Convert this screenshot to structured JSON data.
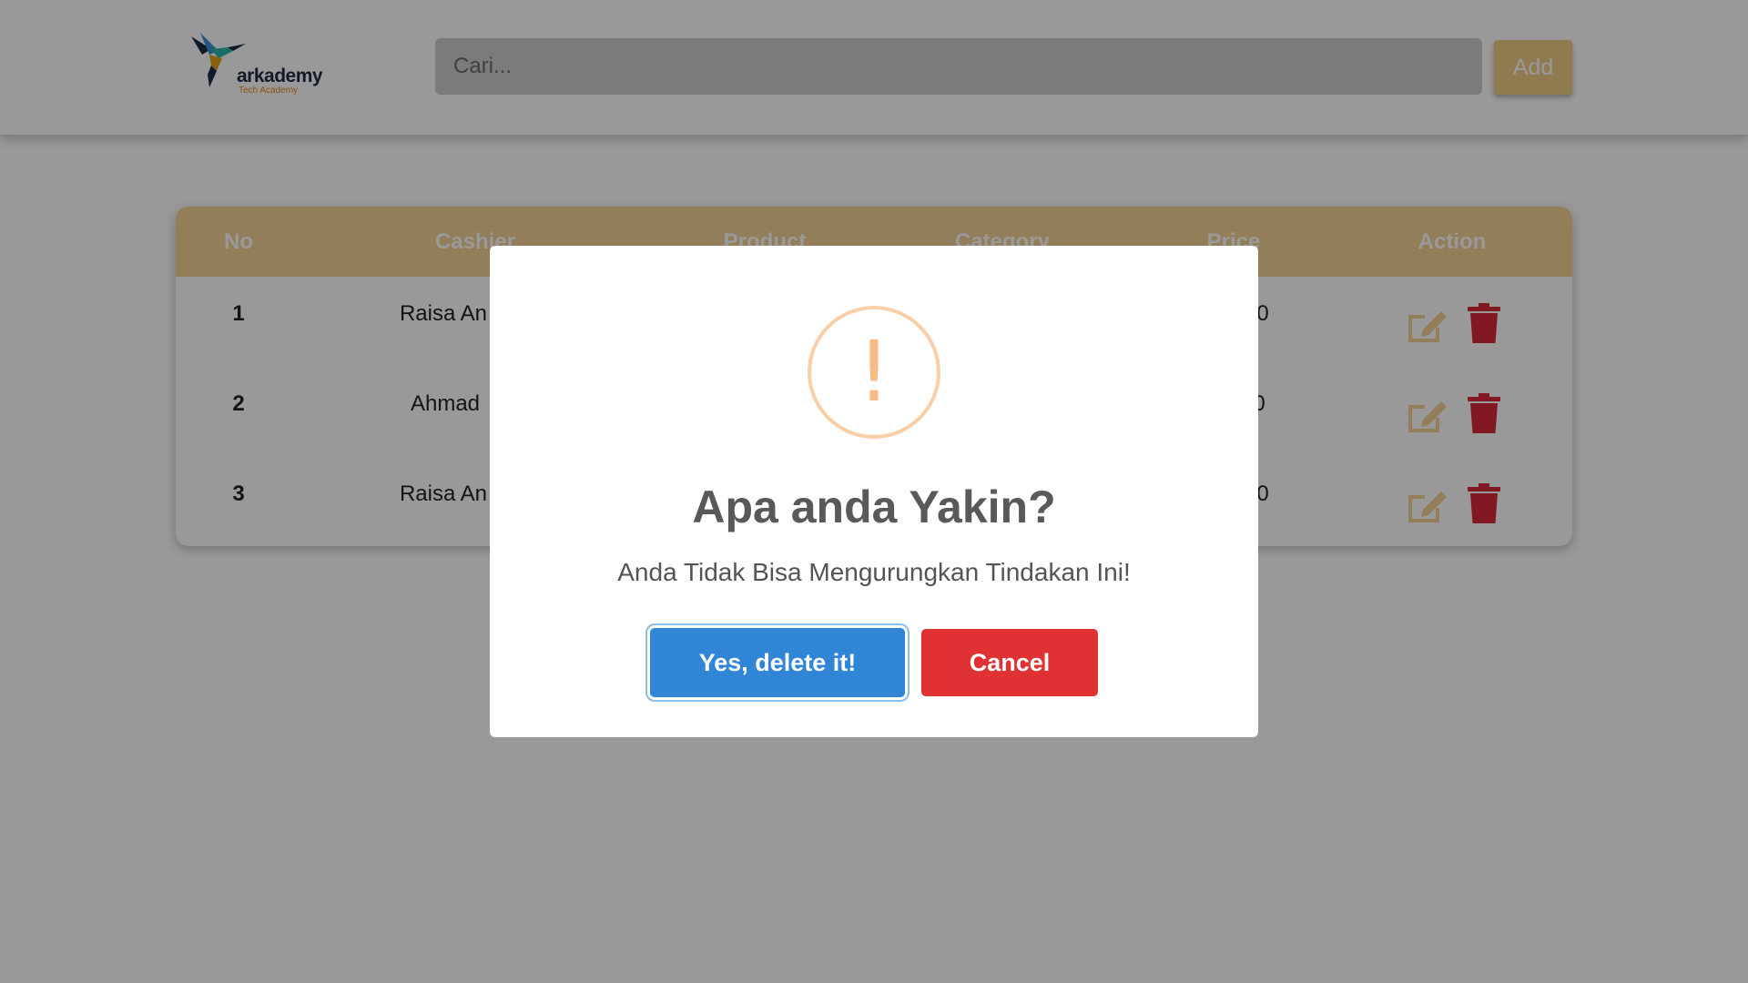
{
  "header": {
    "logo_text": "arkademy",
    "logo_subtext": "Tech Academy",
    "search_placeholder": "Cari...",
    "add_label": "Add"
  },
  "table": {
    "columns": [
      "No",
      "Cashier",
      "Product",
      "Category",
      "Price",
      "Action"
    ],
    "rows": [
      {
        "no": "1",
        "cashier": "Raisa An",
        "price": "0"
      },
      {
        "no": "2",
        "cashier": "Ahmad",
        "price": "0"
      },
      {
        "no": "3",
        "cashier": "Raisa An",
        "price": "0"
      }
    ],
    "action_icons": [
      "edit-icon",
      "trash-icon"
    ]
  },
  "dialog": {
    "icon": "warning-icon",
    "icon_glyph": "!",
    "title": "Apa anda Yakin?",
    "text": "Anda Tidak Bisa Mengurungkan Tindakan Ini!",
    "confirm_label": "Yes, delete it!",
    "cancel_label": "Cancel"
  },
  "colors": {
    "accent": "#f3d293",
    "confirm": "#3085d6",
    "cancel": "#e03232",
    "warning": "#f8bb86",
    "delete_icon": "#d92b3a",
    "edit_icon": "#f3d293"
  }
}
